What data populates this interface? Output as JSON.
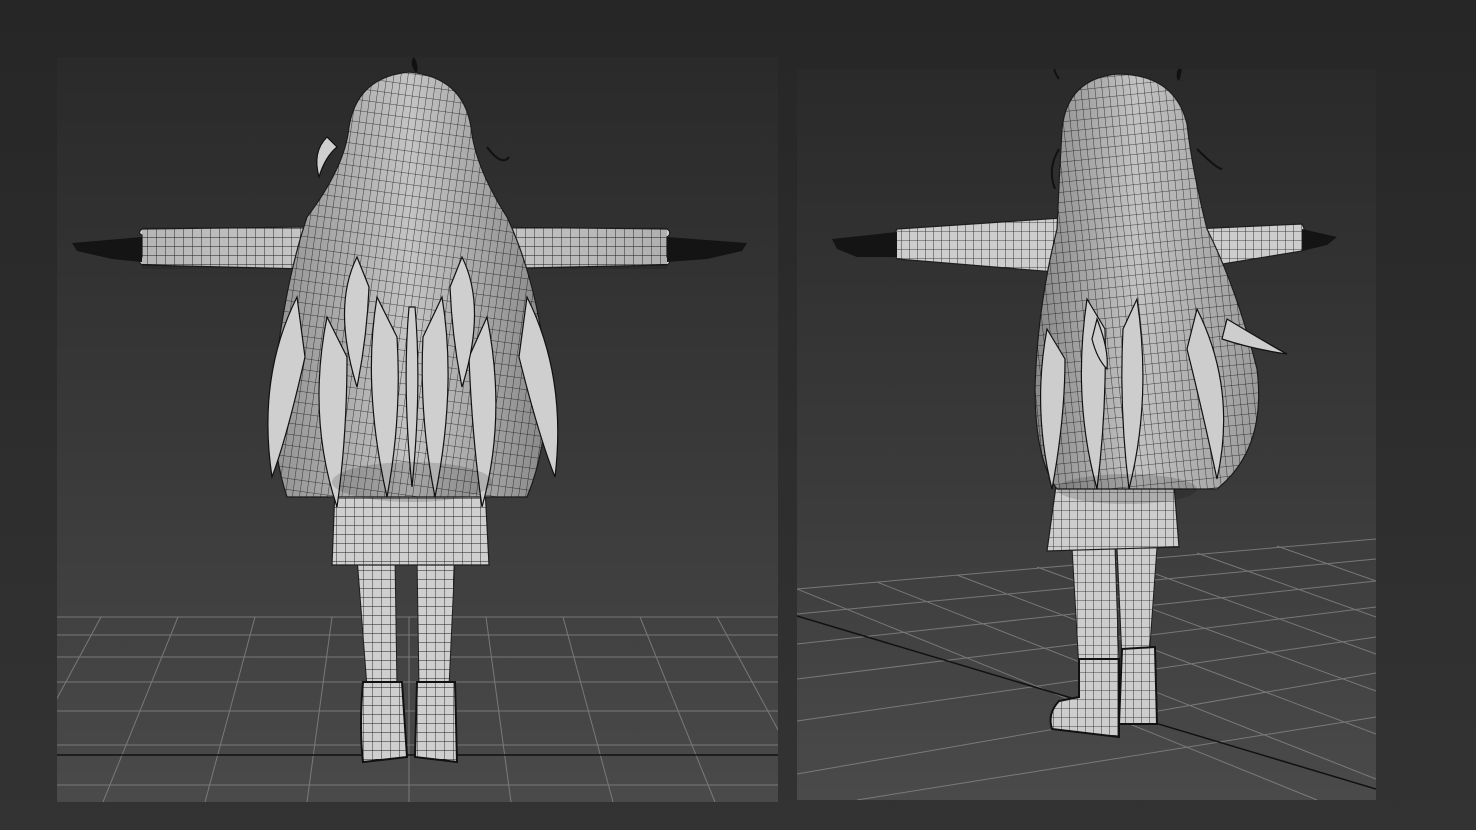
{
  "viewports": [
    {
      "id": "front",
      "view": "back-orthographic",
      "subject": "wireframe-character-model"
    },
    {
      "id": "perspective",
      "view": "three-quarter-perspective",
      "subject": "wireframe-character-model"
    }
  ],
  "colors": {
    "app_background": "#2e2e2e",
    "viewport_top": "#2a2a2a",
    "viewport_bottom": "#4a4a4a",
    "grid_line": "#8a8a8a",
    "mesh_fill": "#cfcfcf",
    "mesh_line": "#1e1e1e",
    "hand_color": "#141414"
  }
}
